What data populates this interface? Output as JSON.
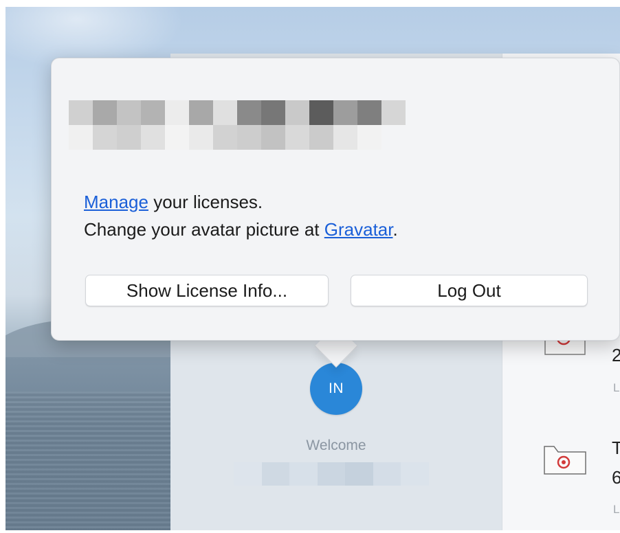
{
  "popover": {
    "manage_link": "Manage",
    "manage_suffix": " your licenses.",
    "avatar_prefix": "Change your avatar picture at ",
    "gravatar_link": "Gravatar",
    "avatar_suffix": ".",
    "show_license_button": "Show License Info...",
    "logout_button": "Log Out"
  },
  "sidebar": {
    "avatar_initials": "IN",
    "welcome_label": "Welcome"
  },
  "colors": {
    "accent": "#2a87d8",
    "link": "#1a5fd8",
    "doc_icon_red": "#d23a3a"
  },
  "content_list": {
    "items": [
      {
        "title_fragment": "2",
        "subtitle_fragment": "L"
      },
      {
        "title_fragment": "T",
        "title_fragment_2": "6",
        "subtitle_fragment": "L"
      }
    ]
  }
}
